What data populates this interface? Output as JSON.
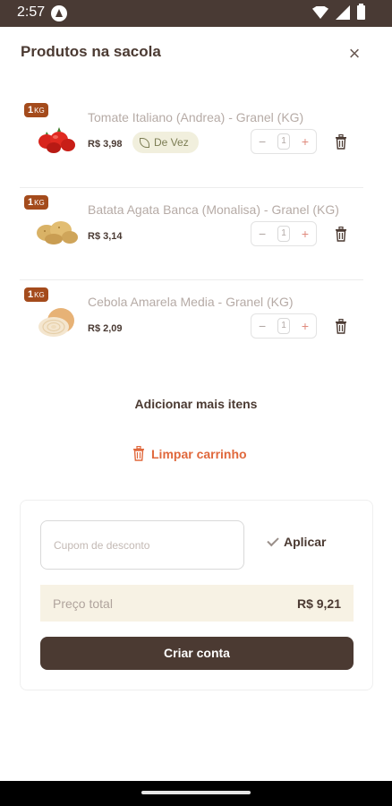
{
  "status_bar": {
    "time": "2:57"
  },
  "sheet": {
    "title": "Produtos na sacola",
    "close_symbol": "×"
  },
  "items": [
    {
      "badge_qty": "1",
      "badge_unit": "KG",
      "name": "Tomate Italiano (Andrea) - Granel (KG)",
      "price": "R$ 3,98",
      "tag": "De Vez",
      "quantity": "1",
      "minus": "−",
      "plus": "+"
    },
    {
      "badge_qty": "1",
      "badge_unit": "KG",
      "name": "Batata Agata Banca (Monalisa) - Granel (KG)",
      "price": "R$ 3,14",
      "quantity": "1",
      "minus": "−",
      "plus": "+"
    },
    {
      "badge_qty": "1",
      "badge_unit": "KG",
      "name": "Cebola Amarela Media - Granel (KG)",
      "price": "R$ 2,09",
      "quantity": "1",
      "minus": "−",
      "plus": "+"
    }
  ],
  "actions": {
    "add_more": "Adicionar mais itens",
    "clear_cart": "Limpar carrinho"
  },
  "summary": {
    "coupon_placeholder": "Cupom de desconto",
    "apply_label": "Aplicar",
    "total_label": "Preço total",
    "total_value": "R$ 9,21",
    "create_account": "Criar conta"
  },
  "colors": {
    "brand_dark": "#4b3a32",
    "accent_orange": "#e0683c",
    "badge": "#a44b1c",
    "total_bg": "#f7f2e4"
  }
}
